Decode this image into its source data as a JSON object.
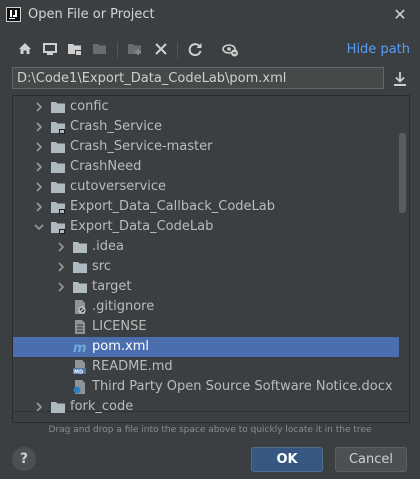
{
  "window": {
    "title": "Open File or Project",
    "close_glyph": "✕"
  },
  "toolbar": {
    "buttons": [
      "home-icon",
      "desktop-icon",
      "project-folder-icon",
      "module-folder-icon",
      "new-folder-icon",
      "delete-icon",
      "refresh-icon",
      "show-hidden-icon"
    ],
    "hide_path_label": "Hide path"
  },
  "path": {
    "value": "D:\\Code1\\Export_Data_CodeLab\\pom.xml"
  },
  "tree": {
    "items": [
      {
        "label": "confic",
        "icon": "folder-icon",
        "expanded": false
      },
      {
        "label": "Crash_Service",
        "icon": "module-folder-icon",
        "expanded": false
      },
      {
        "label": "Crash_Service-master",
        "icon": "folder-icon",
        "expanded": false
      },
      {
        "label": "CrashNeed",
        "icon": "folder-icon",
        "expanded": false
      },
      {
        "label": "cutoverservice",
        "icon": "folder-icon",
        "expanded": false
      },
      {
        "label": "Export_Data_Callback_CodeLab",
        "icon": "module-folder-icon",
        "expanded": false
      },
      {
        "label": "Export_Data_CodeLab",
        "icon": "module-folder-icon",
        "expanded": true
      },
      {
        "label": ".idea",
        "icon": "folder-icon",
        "expanded": false
      },
      {
        "label": "src",
        "icon": "folder-icon",
        "expanded": false
      },
      {
        "label": "target",
        "icon": "folder-icon",
        "expanded": false
      },
      {
        "label": ".gitignore",
        "icon": "gitignore-file-icon"
      },
      {
        "label": "LICENSE",
        "icon": "text-file-icon"
      },
      {
        "label": "pom.xml",
        "icon": "maven-file-icon",
        "selected": true
      },
      {
        "label": "README.md",
        "icon": "markdown-file-icon"
      },
      {
        "label": "Third Party Open Source Software Notice.docx",
        "icon": "docx-file-icon"
      },
      {
        "label": "fork_code",
        "icon": "folder-icon",
        "expanded": false
      }
    ]
  },
  "hint": "Drag and drop a file into the space above to quickly locate it in the tree",
  "buttons": {
    "help": "?",
    "ok": "OK",
    "cancel": "Cancel"
  },
  "colors": {
    "background": "#3c3f41",
    "selection": "#4b6eaf",
    "link": "#589df6",
    "ok_button": "#365880"
  }
}
